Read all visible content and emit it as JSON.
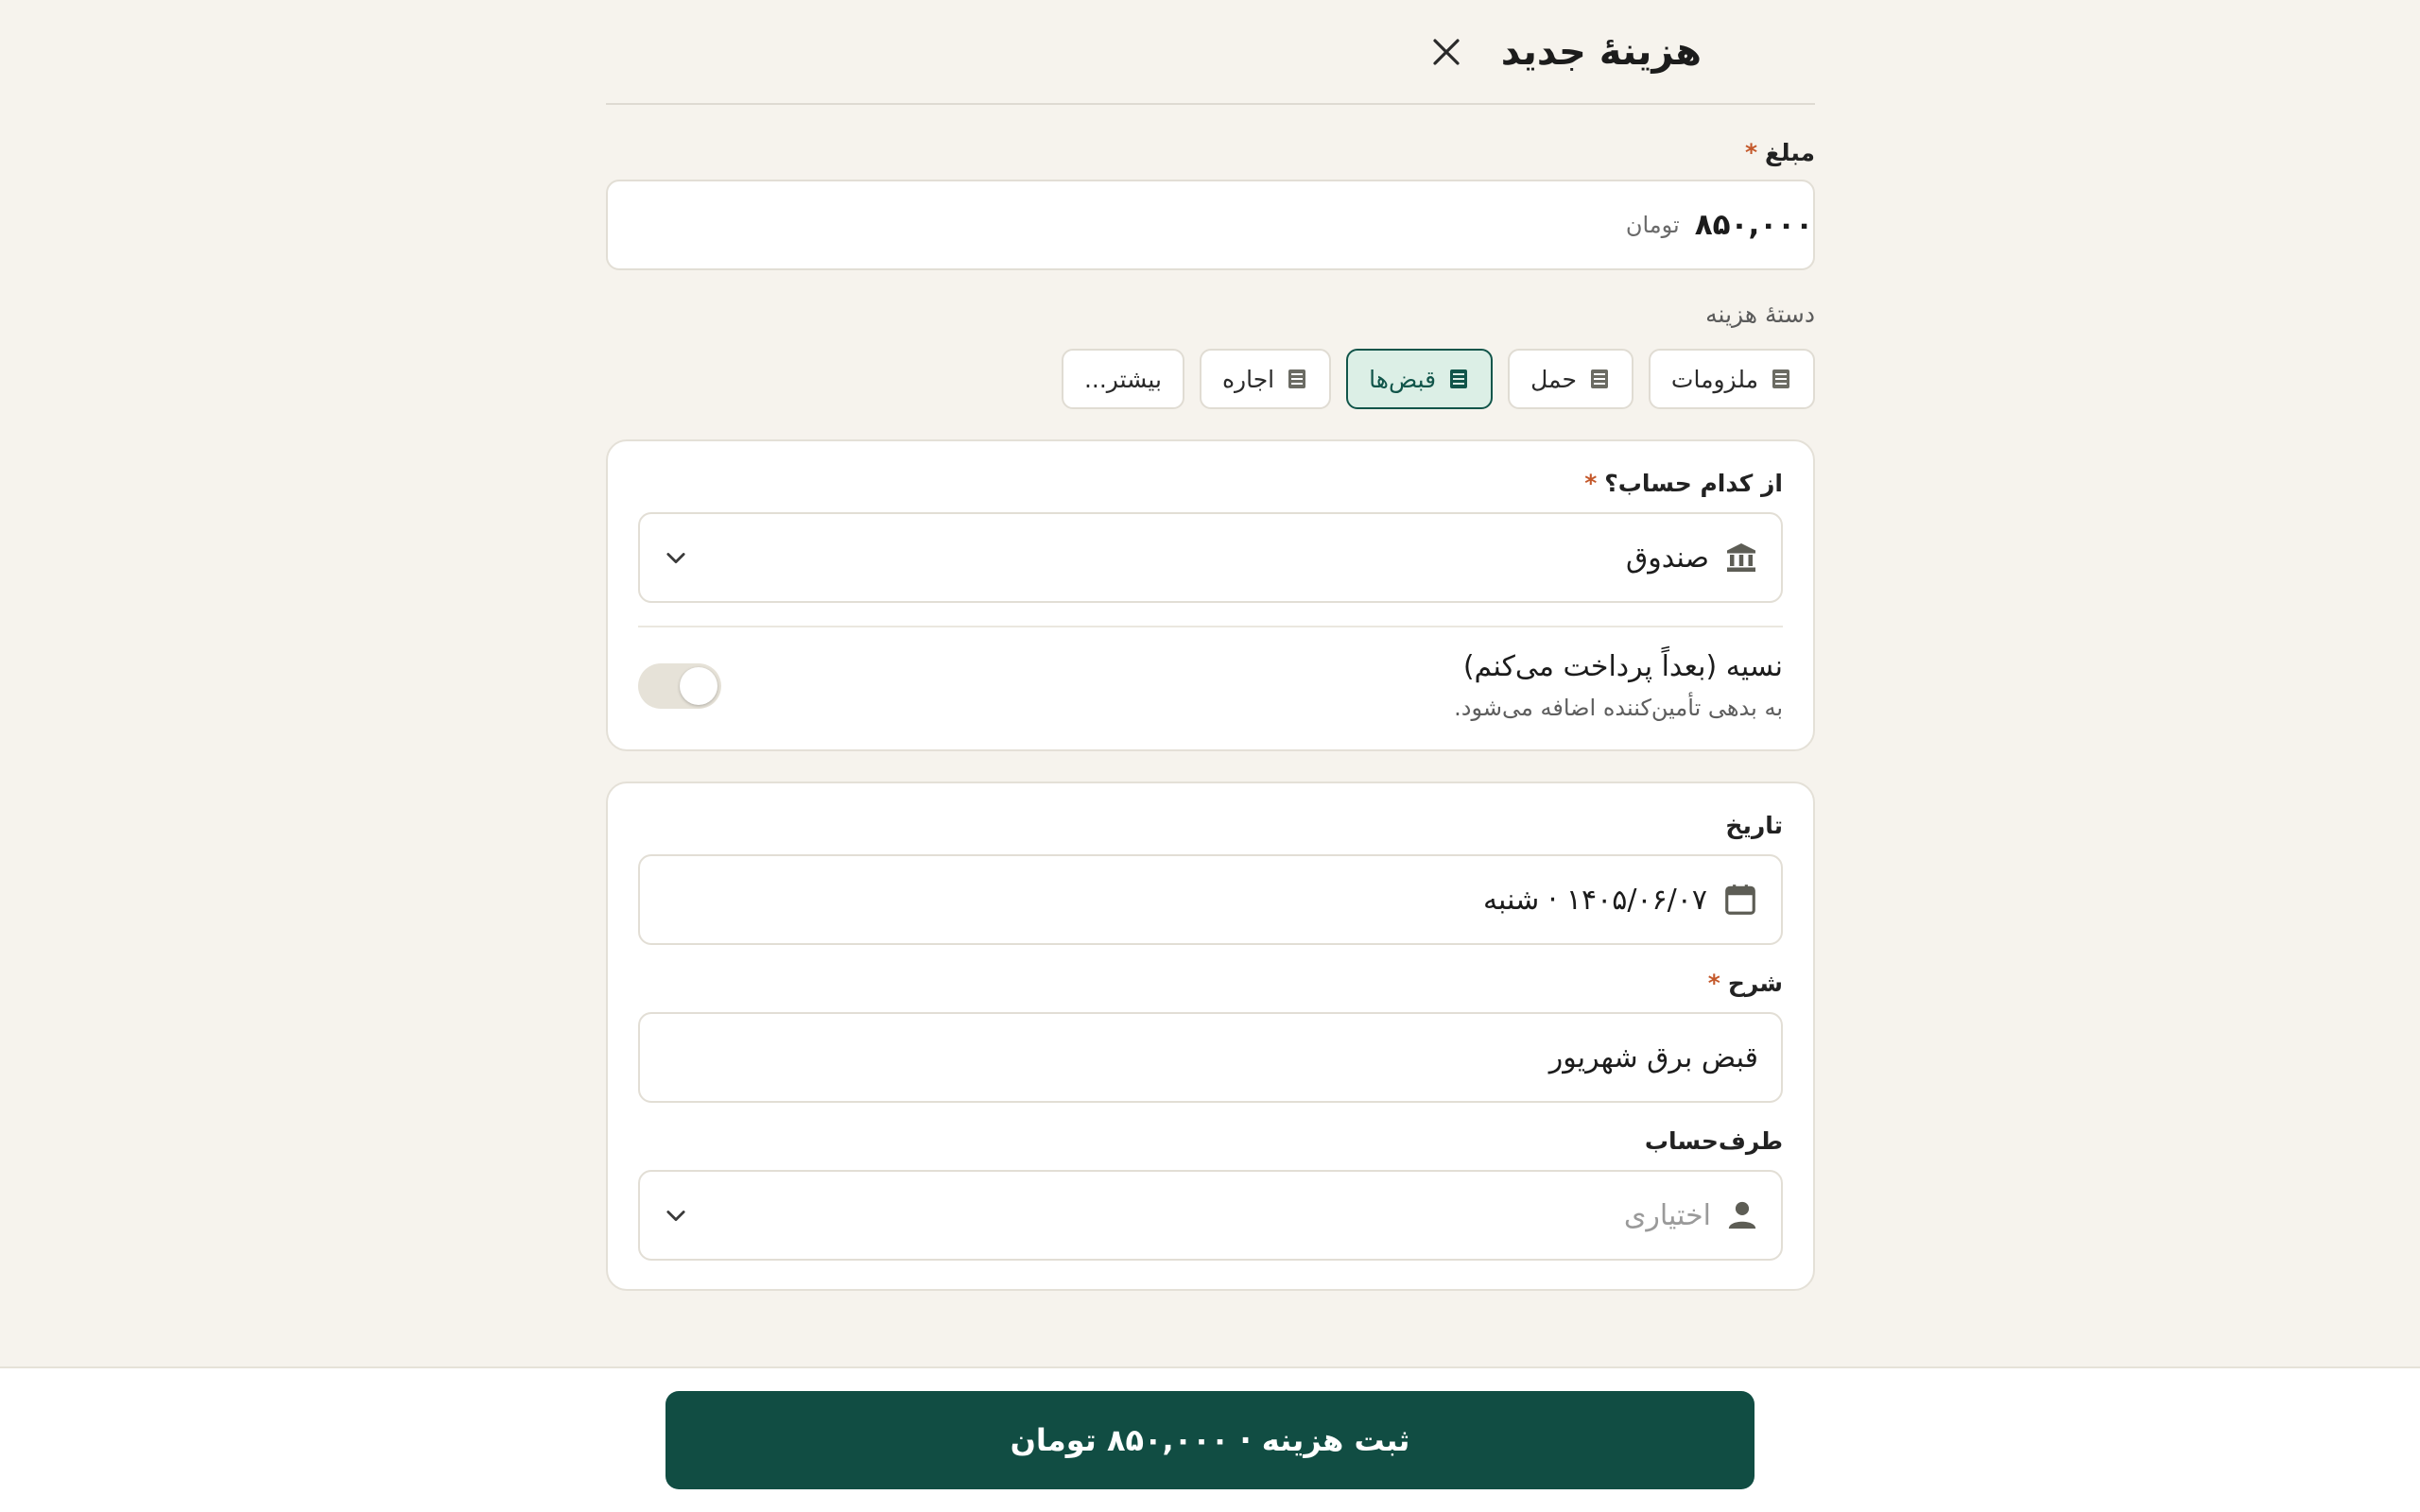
{
  "header": {
    "title": "هزینهٔ جدید",
    "close_icon": "close-icon"
  },
  "amount": {
    "label": "مبلغ",
    "required_mark": "*",
    "value": "۸۵۰,۰۰۰",
    "unit": "تومان"
  },
  "category": {
    "label": "دستهٔ هزینه",
    "chips": [
      {
        "label": "ملزومات",
        "icon": "receipt-icon",
        "active": false
      },
      {
        "label": "حمل",
        "icon": "receipt-icon",
        "active": false
      },
      {
        "label": "قبض‌ها",
        "icon": "receipt-icon",
        "active": true
      },
      {
        "label": "اجاره",
        "icon": "receipt-icon",
        "active": false
      },
      {
        "label": "بیشتر...",
        "icon": "",
        "active": false
      }
    ]
  },
  "account": {
    "label": "از کدام حساب؟",
    "required_mark": "*",
    "value": "صندوق",
    "icon": "bank-icon"
  },
  "credit": {
    "title": "نسیه (بعداً پرداخت می‌کنم)",
    "subtitle": "به بدهی تأمین‌کننده اضافه می‌شود.",
    "enabled": false
  },
  "date": {
    "label": "تاریخ",
    "value": "۱۴۰۵/۰۶/۰۷ · شنبه",
    "icon": "calendar-icon"
  },
  "description": {
    "label": "شرح",
    "required_mark": "*",
    "value": "قبض برق شهریور"
  },
  "counterparty": {
    "label": "طرف‌حساب",
    "placeholder": "اختیاری",
    "icon": "person-icon"
  },
  "submit": {
    "label": "ثبت هزینه · ۸۵۰,۰۰۰ تومان"
  },
  "colors": {
    "primary": "#114d43",
    "accent_required": "#c4582a",
    "background": "#f6f3ed",
    "chip_active_bg": "#dcefe6"
  }
}
